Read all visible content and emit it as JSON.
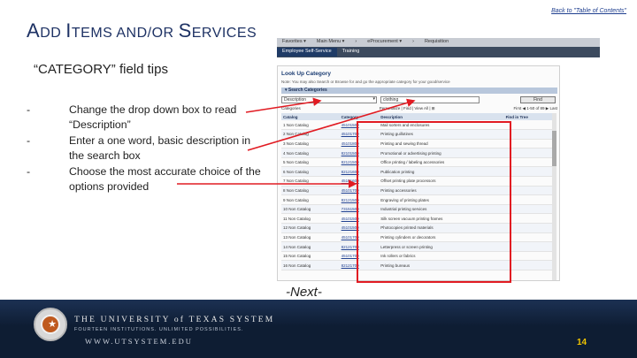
{
  "header": {
    "back_link": "Back to \"Table of Contents\"",
    "title": {
      "a1": "A",
      "a2": "DD ",
      "i1": "I",
      "i2": "TEMS AND/OR ",
      "s1": "S",
      "s2": "ERVICES"
    }
  },
  "subtitle": "“CATEGORY” field tips",
  "bullets": [
    {
      "dash": "-",
      "text": "Change the drop down box to read “Description”"
    },
    {
      "dash": "-",
      "text": "Enter a one word, basic description in the search box"
    },
    {
      "dash": "-",
      "text": "Choose the most accurate choice of the options provided"
    }
  ],
  "menu_strip": {
    "row1": [
      "Favorites ▾",
      "Main Menu ▾",
      "›",
      "eProcurement ▾",
      "›",
      "Requisition"
    ],
    "tabs": [
      "Employee Self-Service",
      "Training"
    ]
  },
  "lookup": {
    "title": "Look Up Category",
    "help": "Note: You may also Search or Browse for and go the appropriate category for your good/service",
    "section": "▾ Search Categories",
    "search_by": "Description",
    "search_text": "clothing",
    "find_button": "Find",
    "nav_left": "Categories",
    "nav_mid": "Personalize | Find | View All | ⊞",
    "nav_right": "First ◀ 1-50 of 89 ▶ Last",
    "columns": [
      "Catalog",
      "Category",
      "Description",
      "Find in Tree"
    ],
    "rows": [
      [
        "1 Non Catalog",
        "45101500",
        "Mail sorters and enclosures",
        ""
      ],
      [
        "2 Non Catalog",
        "45101700",
        "Printing guillotines",
        ""
      ],
      [
        "3 Non Catalog",
        "45101800",
        "Printing and sewing thread",
        ""
      ],
      [
        "4 Non Catalog",
        "82101500",
        "Promotional or advertising printing",
        ""
      ],
      [
        "5 Non Catalog",
        "82121500",
        "Office printing / labeling accessories",
        ""
      ],
      [
        "6 Non Catalog",
        "82121600",
        "Publication printing",
        ""
      ],
      [
        "7 Non Catalog",
        "45101600",
        "Offset printing plate processors",
        ""
      ],
      [
        "8 Non Catalog",
        "45101700",
        "Printing accessories",
        ""
      ],
      [
        "9 Non Catalog",
        "82121500",
        "Engraving of printing plates",
        ""
      ],
      [
        "10 Non Catalog",
        "73151500",
        "Industrial printing services",
        ""
      ],
      [
        "11 Non Catalog",
        "45101500",
        "Silk screen vacuum printing frames",
        ""
      ],
      [
        "12 Non Catalog",
        "45101500",
        "Photocopies printed materials",
        ""
      ],
      [
        "13 Non Catalog",
        "45101700",
        "Printing cylinders or decorators",
        ""
      ],
      [
        "14 Non Catalog",
        "82121700",
        "Letterpress or screen printing",
        ""
      ],
      [
        "15 Non Catalog",
        "45101700",
        "Ink rollers or fabrics",
        ""
      ],
      [
        "16 Non Catalog",
        "82121700",
        "Printing bureaus",
        ""
      ]
    ]
  },
  "next_label": "-Next-",
  "footer": {
    "university": "THE UNIVERSITY of TEXAS SYSTEM",
    "tagline": "FOURTEEN INSTITUTIONS. UNLIMITED POSSIBILITIES.",
    "url": "WWW.UTSYSTEM.EDU",
    "page_number": "14",
    "colors": {
      "background": "#0e1d33",
      "page_number": "#f0c400",
      "highlight": "#e11b22"
    }
  }
}
